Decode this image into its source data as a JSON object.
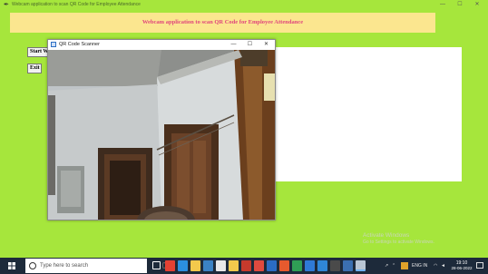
{
  "main_window": {
    "title": "Webcam application to scan QR Code for Employee Attendance",
    "controls": {
      "minimize": "—",
      "maximize": "☐",
      "close": "✕"
    }
  },
  "banner": {
    "text": "Webcam application to scan QR Code for Employee Attendance"
  },
  "buttons": {
    "start": "Start W",
    "exit": "Exit"
  },
  "scanner_window": {
    "title": "QR Code Scanner",
    "controls": {
      "minimize": "—",
      "maximize": "☐",
      "close": "✕"
    }
  },
  "watermark": {
    "title": "Activate Windows",
    "subtitle": "Go to Settings to activate Windows."
  },
  "taskbar": {
    "search_placeholder": "Type here to search",
    "apps": [
      {
        "icon": "task-view-icon",
        "color": "#ffffff"
      },
      {
        "icon": "chrome-icon",
        "color": "#e34133"
      },
      {
        "icon": "edge-icon",
        "color": "#2b8fe0"
      },
      {
        "icon": "explorer-icon",
        "color": "#f2c94c"
      },
      {
        "icon": "store-icon",
        "color": "#3b82c4"
      },
      {
        "icon": "bag-icon",
        "color": "#e8e8e8"
      },
      {
        "icon": "chat-icon",
        "color": "#f2c94c"
      },
      {
        "icon": "settings-icon",
        "color": "#c73a2c"
      },
      {
        "icon": "red-app-icon",
        "color": "#e04a3f"
      },
      {
        "icon": "blue-app-icon",
        "color": "#2b6cc4"
      },
      {
        "icon": "slides-icon",
        "color": "#e65a2e"
      },
      {
        "icon": "docs-icon",
        "color": "#2f9e55"
      },
      {
        "icon": "mail-icon",
        "color": "#2f7ad6"
      },
      {
        "icon": "vscode-icon",
        "color": "#2f86d6"
      },
      {
        "icon": "terminal-icon",
        "color": "#4a4a4a"
      },
      {
        "icon": "python-icon",
        "color": "#3b6fb0"
      },
      {
        "icon": "active-app-icon",
        "color": "#b9c6d4"
      }
    ],
    "tray": {
      "language": "ENG",
      "lang_sub": "IN"
    },
    "clock": {
      "time": "19:10",
      "date": "28-06-2022"
    }
  }
}
